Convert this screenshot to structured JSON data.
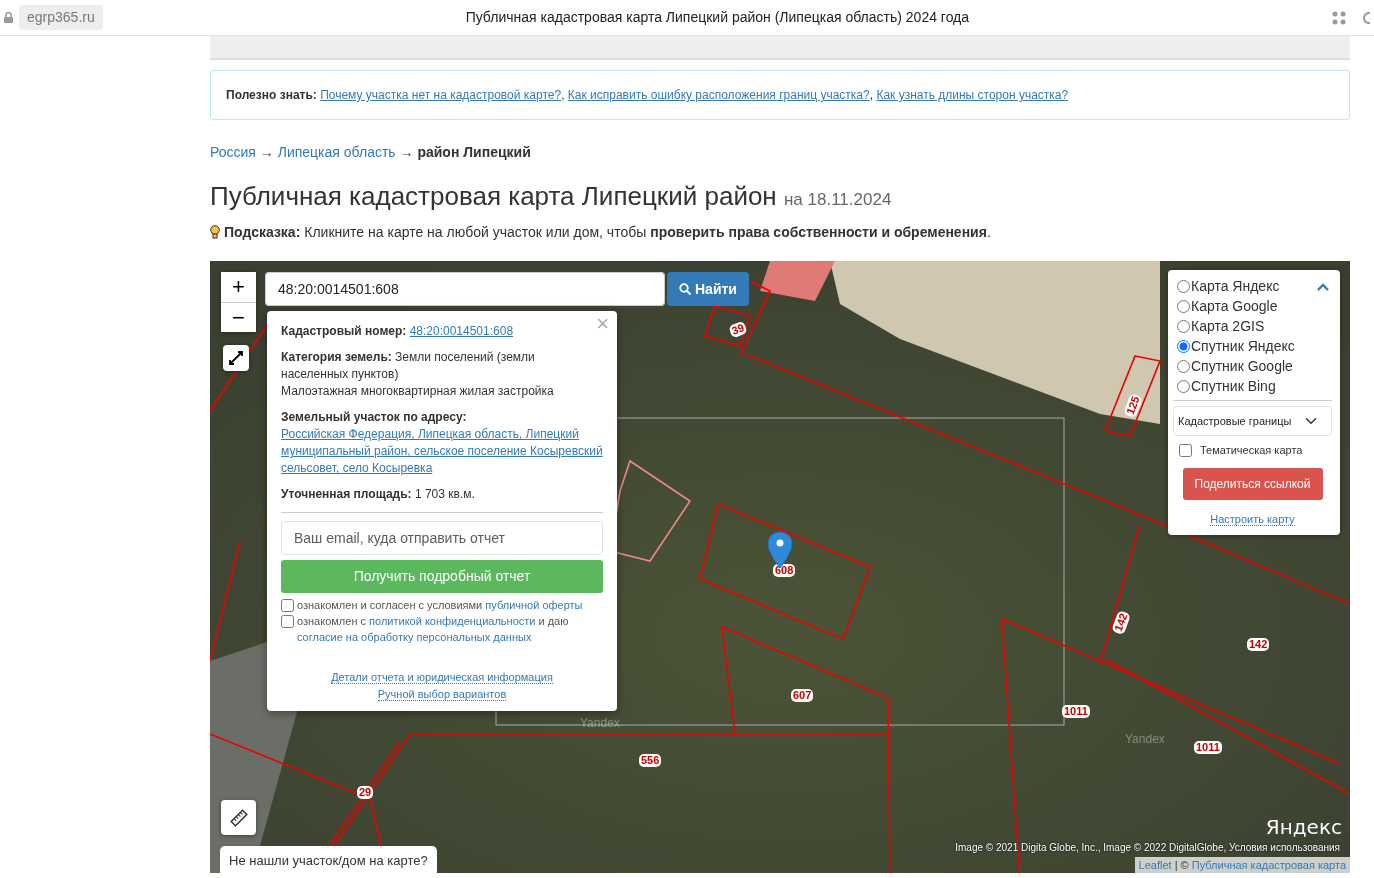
{
  "browser": {
    "url": "egrp365.ru",
    "title": "Публичная кадастровая карта Липецкий район (Липецкая область) 2024 года"
  },
  "notice": {
    "label": "Полезно знать:",
    "separator": ",",
    "links": [
      "Почему участка нет на кадастровой карте?",
      "Как исправить ошибку расположения границ участка?",
      "Как узнать длины сторон участка?"
    ]
  },
  "breadcrumbs": [
    {
      "text": "Россия",
      "kind": "link"
    },
    {
      "text": "Липецкая область",
      "kind": "link",
      "separator": "→"
    },
    {
      "text": "район Липецкий",
      "kind": "current",
      "separator": "→"
    }
  ],
  "heading": {
    "title": "Публичная кадастровая карта Липецкий район",
    "date": "на 18.11.2024"
  },
  "hint": {
    "label": "Подсказка:",
    "text": "Кликните на карте на любой участок или дом, чтобы **проверить права собственности и обременения**."
  },
  "map": {
    "zoom_in": "+",
    "zoom_out": "−",
    "search": {
      "value": "48:20:0014501:608",
      "button": "Найти"
    },
    "popup": {
      "close": "×",
      "fields": [
        {
          "kind": "link",
          "label": "Кадастровый номер:",
          "value": "48:20:0014501:608"
        },
        {
          "kind": "text",
          "label": "Категория земель:",
          "value": "Земли поселений (земли населенных пунктов)",
          "extra": "Малоэтажная многоквартирная жилая застройка"
        },
        {
          "kind": "link",
          "label": "Земельный участок по адресу:",
          "value": "Российская Федерация, Липецкая область, Липецкий муниципальный район, сельское поселение Косыревский сельсовет, село Косыревка"
        },
        {
          "kind": "text",
          "label": "Уточненная площадь:",
          "value": "1 703 кв.м."
        }
      ],
      "email_placeholder": "Ваш email, куда отправить отчет",
      "submit": "Получить подробный отчет",
      "consents": [
        {
          "checked": false,
          "parts": [
            {
              "text": "ознакомлен и согласен с условиями",
              "kind": "text"
            },
            {
              "text": "публичной оферты",
              "kind": "link"
            }
          ]
        },
        {
          "checked": false,
          "parts": [
            {
              "text": "ознакомлен с",
              "kind": "text"
            },
            {
              "text": "политикой конфиденциальности",
              "kind": "link"
            },
            {
              "text": "и даю",
              "kind": "text"
            },
            {
              "text": "согласие на обработку персональных данных",
              "kind": "link"
            }
          ]
        }
      ],
      "footer_links": [
        "Детали отчета и юридическая информация",
        "Ручной выбор вариантов"
      ]
    },
    "layers": {
      "options": [
        {
          "label": "Карта Яндекс",
          "selected": false
        },
        {
          "label": "Карта Google",
          "selected": false
        },
        {
          "label": "Карта 2GIS",
          "selected": false
        },
        {
          "label": "Спутник Яндекс",
          "selected": true
        },
        {
          "label": "Спутник Google",
          "selected": false
        },
        {
          "label": "Спутник Bing",
          "selected": false
        }
      ],
      "overlay_select": "Кадастровые границы",
      "thematic": {
        "label": "Тематическая карта",
        "checked": false
      },
      "share": "Поделиться ссылкой",
      "configure": "Настроить карту"
    },
    "parcel_labels": [
      "39",
      "125",
      "608",
      "607",
      "556",
      "1011",
      "1011",
      "142",
      "142",
      "29"
    ],
    "watermarks": [
      "Yandex",
      "Yandex"
    ],
    "logo": "Яндекс",
    "not_found": "Не нашли участок/дом на карте?",
    "attribution": {
      "text": "Image © 2021 Digita Globe, Inc., Image © 2022 DigitalGlobe, Условия использования",
      "separator": "|",
      "copyright": "©",
      "links": [
        "Leaflet",
        "Публичная кадастровая карта"
      ]
    }
  }
}
